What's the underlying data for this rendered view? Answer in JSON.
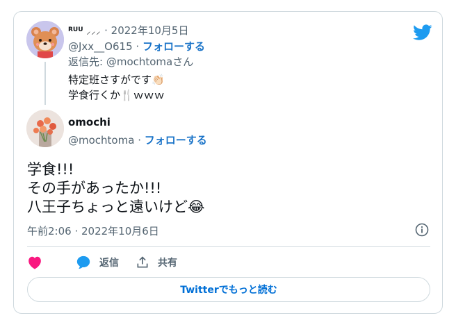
{
  "reply_tweet": {
    "author_name": "RUU",
    "author_name_suffix": "⸝‍⸝‍⸝",
    "date": "2022年10月5日",
    "handle": "@Jxx__O615",
    "follow_label": "フォローする",
    "reply_to_prefix": "返信先: ",
    "reply_to_handle": "@mochtoma",
    "reply_to_suffix": "さん",
    "text_line1": "特定班さすがです👏🏻",
    "text_line2": "学食行くか🍴ｗｗｗ"
  },
  "main_tweet": {
    "author_name": "omochi",
    "handle": "@mochtoma",
    "follow_label": "フォローする",
    "text_line1": "学食!!!",
    "text_line2": "その手があったか!!!",
    "text_line3": "八王子ちょっと遠いけど😂",
    "timestamp": "午前2:06 · 2022年10月6日"
  },
  "actions": {
    "reply_label": "返信",
    "share_label": "共有"
  },
  "read_more_label": "Twitterでもっと読む",
  "colors": {
    "twitter_blue": "#1d9bf0",
    "like_pink": "#f91880",
    "text_primary": "#0f1419",
    "text_secondary": "#536471",
    "border": "#cfd9de"
  },
  "icons": [
    "twitter-bird-icon",
    "info-icon",
    "heart-icon",
    "reply-bubble-icon",
    "share-icon"
  ]
}
